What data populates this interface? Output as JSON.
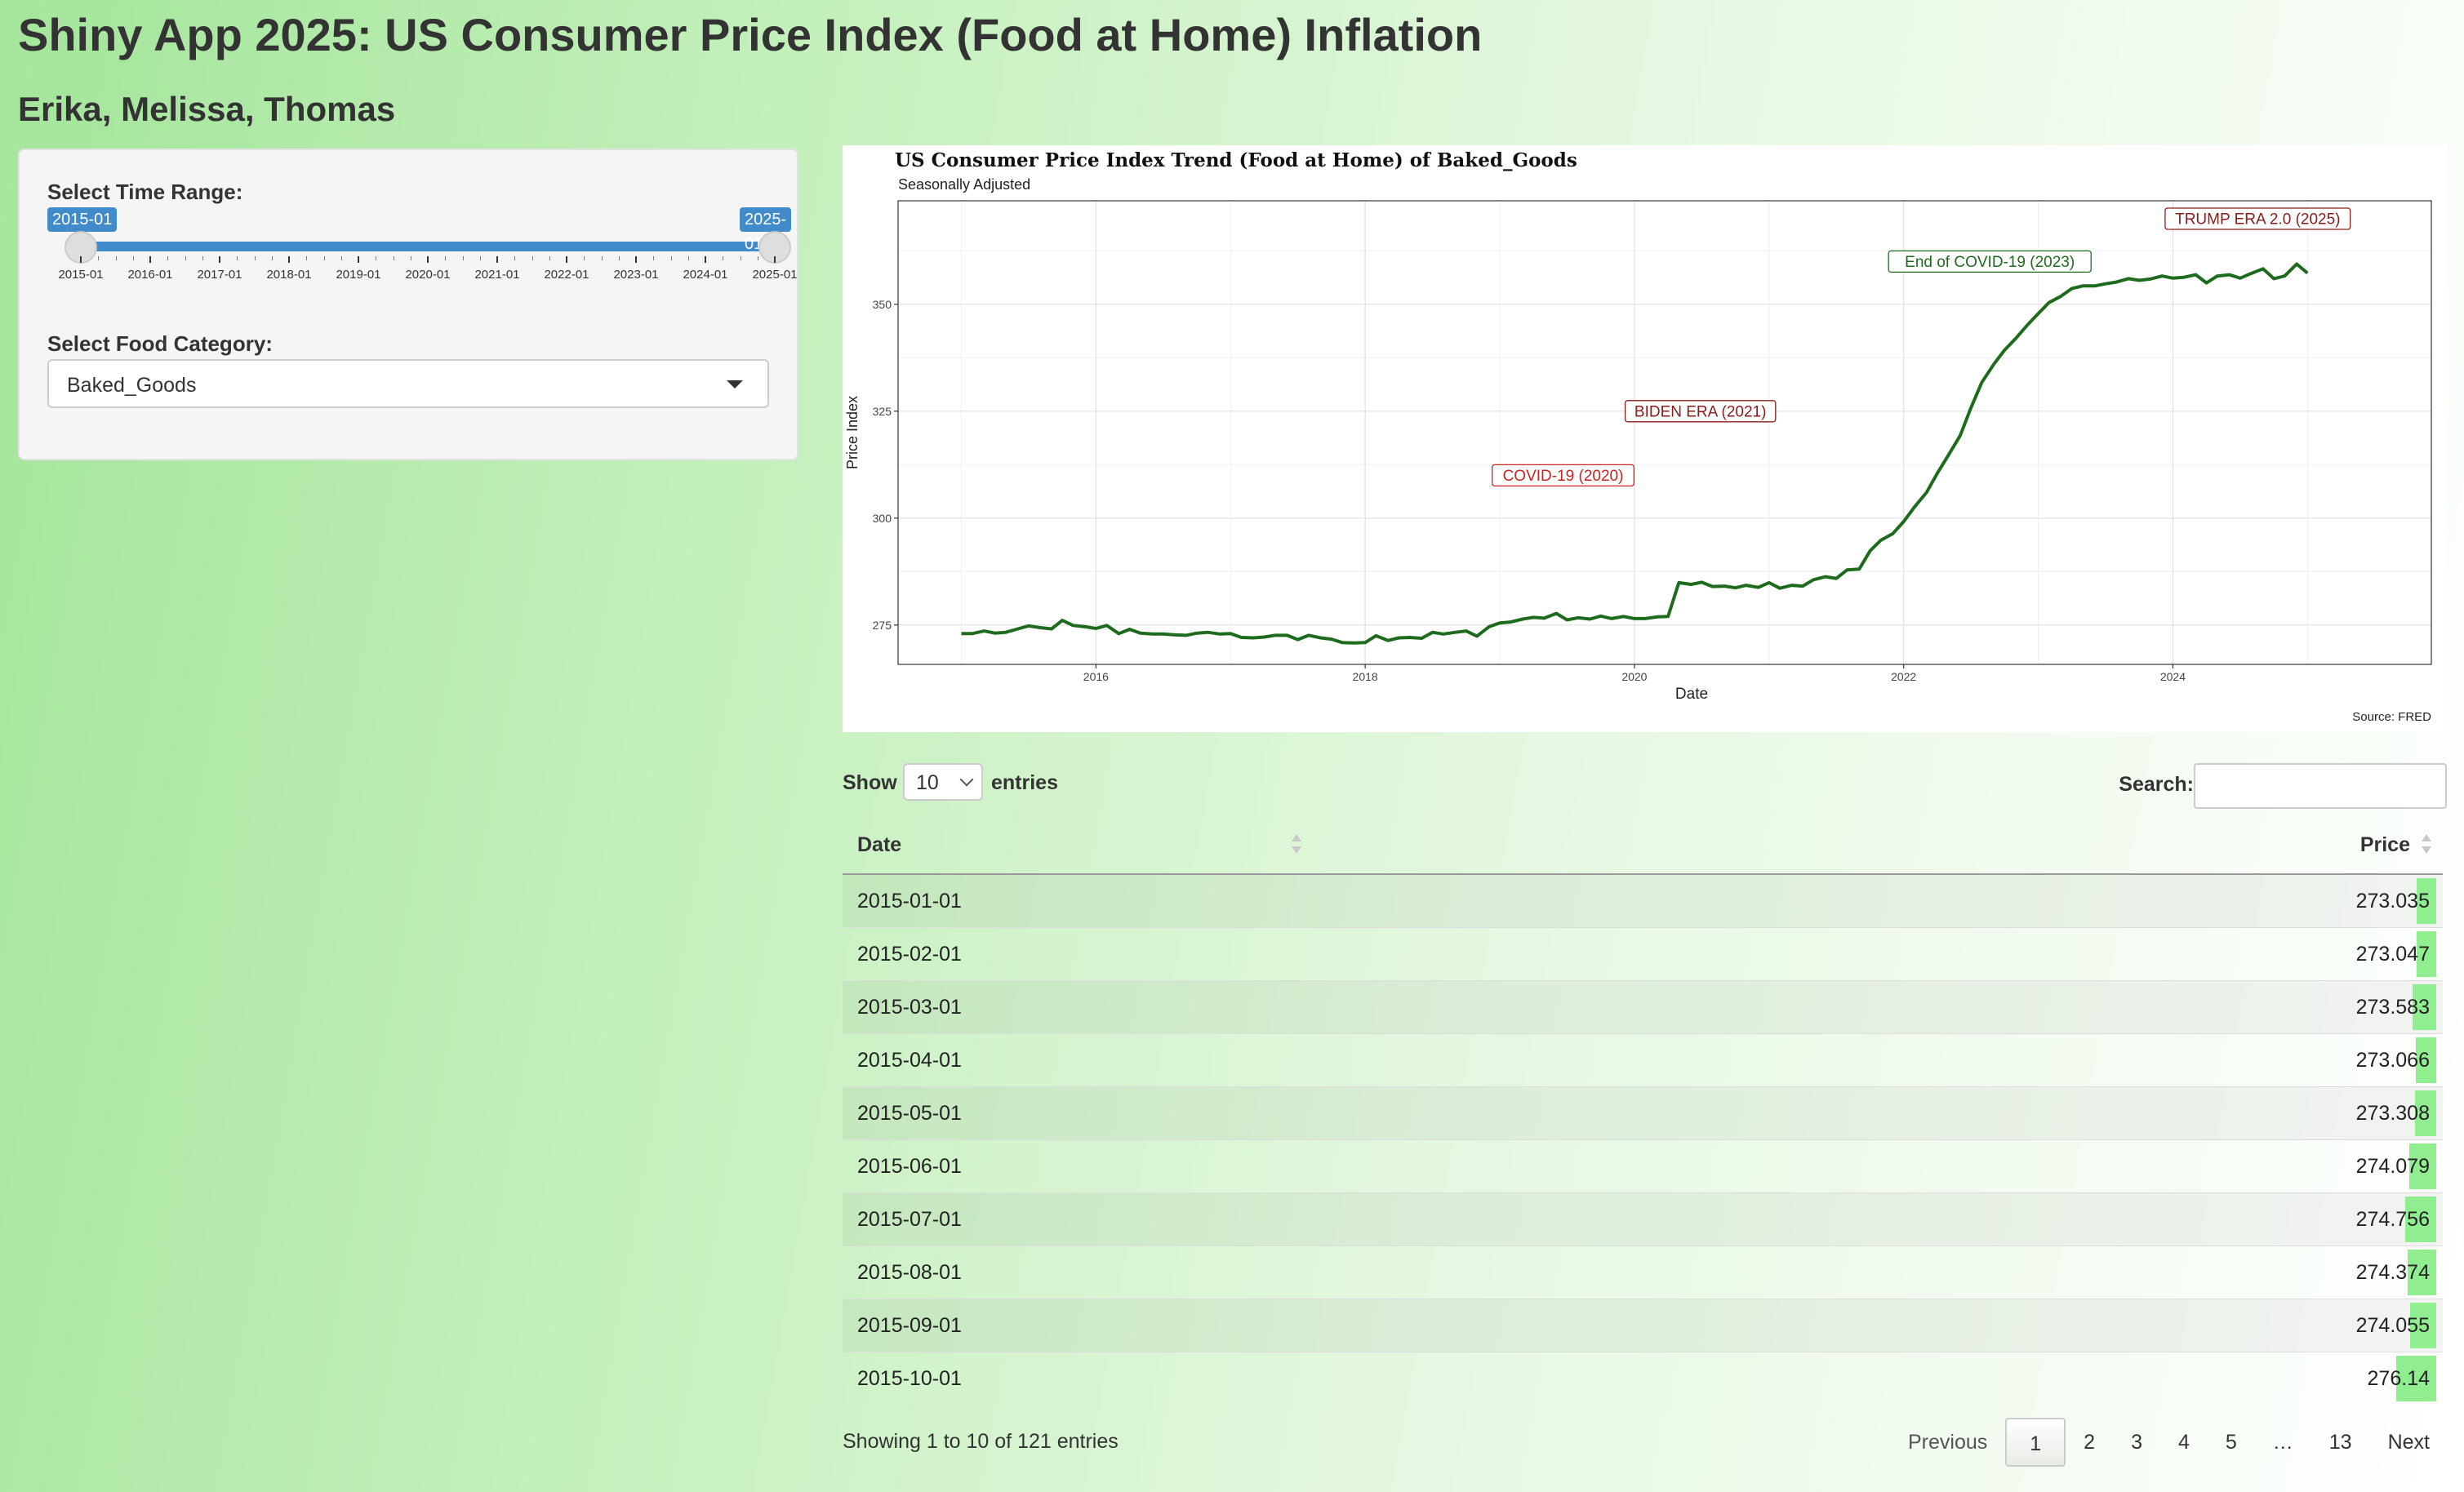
{
  "app": {
    "title": "Shiny App 2025: US Consumer Price Index (Food at Home) Inflation",
    "authors": "Erika, Melissa, Thomas"
  },
  "sidebar": {
    "time_range_label": "Select Time Range:",
    "range_start": "2015-01",
    "range_end": "2025-01",
    "slider_ticks": [
      "2015-01",
      "2016-01",
      "2017-01",
      "2018-01",
      "2019-01",
      "2020-01",
      "2021-01",
      "2022-01",
      "2023-01",
      "2024-01",
      "2025-01"
    ],
    "food_category_label": "Select Food Category:",
    "food_category_value": "Baked_Goods"
  },
  "chart_data": {
    "type": "line",
    "title": "US Consumer Price Index Trend (Food at Home) of Baked_Goods",
    "subtitle": "Seasonally Adjusted",
    "xlabel": "Date",
    "ylabel": "Price Index",
    "caption": "Source: FRED",
    "xlim": [
      2014.53,
      2025.92
    ],
    "ylim": [
      265.8,
      374.2
    ],
    "x_ticks": [
      2016,
      2018,
      2020,
      2022,
      2024
    ],
    "y_ticks": [
      275,
      300,
      325,
      350
    ],
    "grid": true,
    "line_color": "#1e6b1e",
    "series": [
      {
        "x": [
          2015.0,
          2015.08,
          2015.17,
          2015.25,
          2015.33,
          2015.42,
          2015.5,
          2015.58,
          2015.67,
          2015.75,
          2015.83,
          2015.92,
          2016.0,
          2016.08,
          2016.17,
          2016.25,
          2016.33,
          2016.42,
          2016.5,
          2016.58,
          2016.67,
          2016.75,
          2016.83,
          2016.92,
          2017.0,
          2017.08,
          2017.17,
          2017.25,
          2017.33,
          2017.42,
          2017.5,
          2017.58,
          2017.67,
          2017.75,
          2017.83,
          2017.92,
          2018.0,
          2018.08,
          2018.17,
          2018.25,
          2018.33,
          2018.42,
          2018.5,
          2018.58,
          2018.67,
          2018.75,
          2018.83,
          2018.92,
          2019.0,
          2019.08,
          2019.17,
          2019.25,
          2019.33,
          2019.42,
          2019.5,
          2019.58,
          2019.67,
          2019.75,
          2019.83,
          2019.92,
          2020.0,
          2020.08,
          2020.17,
          2020.25,
          2020.33,
          2020.42,
          2020.5,
          2020.58,
          2020.67,
          2020.75,
          2020.83,
          2020.92,
          2021.0,
          2021.08,
          2021.17,
          2021.25,
          2021.33,
          2021.42,
          2021.5,
          2021.58,
          2021.67,
          2021.75,
          2021.83,
          2021.92,
          2022.0,
          2022.08,
          2022.17,
          2022.25,
          2022.33,
          2022.42,
          2022.5,
          2022.58,
          2022.67,
          2022.75,
          2022.83,
          2022.92,
          2023.0,
          2023.08,
          2023.17,
          2023.25,
          2023.33,
          2023.42,
          2023.5,
          2023.58,
          2023.67,
          2023.75,
          2023.83,
          2023.92,
          2024.0,
          2024.08,
          2024.17,
          2024.25,
          2024.33,
          2024.42,
          2024.5,
          2024.58,
          2024.67,
          2024.75,
          2024.83,
          2024.92,
          2025.0
        ],
        "y": [
          273.0,
          273.0,
          273.6,
          273.1,
          273.3,
          274.1,
          274.8,
          274.4,
          274.1,
          276.1,
          274.9,
          274.6,
          274.2,
          274.9,
          273.0,
          274.0,
          273.1,
          272.9,
          272.9,
          272.7,
          272.6,
          273.1,
          273.3,
          272.9,
          273.0,
          272.1,
          272.0,
          272.2,
          272.6,
          272.6,
          271.6,
          272.6,
          272.0,
          271.7,
          270.9,
          270.8,
          270.9,
          272.5,
          271.4,
          272.0,
          272.1,
          271.9,
          273.3,
          272.9,
          273.3,
          273.6,
          272.4,
          274.6,
          275.5,
          275.7,
          276.4,
          276.8,
          276.6,
          277.7,
          276.2,
          276.7,
          276.4,
          277.1,
          276.5,
          277.0,
          276.5,
          276.5,
          276.9,
          277.0,
          284.9,
          284.5,
          285.0,
          284.0,
          284.1,
          283.7,
          284.3,
          283.8,
          284.9,
          283.6,
          284.3,
          284.1,
          285.6,
          286.3,
          285.9,
          287.9,
          288.1,
          292.3,
          294.8,
          296.4,
          299.2,
          302.6,
          306.0,
          310.5,
          314.6,
          319.3,
          325.8,
          331.7,
          336.0,
          339.3,
          341.9,
          345.2,
          347.8,
          350.4,
          351.9,
          353.7,
          354.3,
          354.3,
          354.8,
          355.2,
          356.0,
          355.6,
          355.9,
          356.6,
          356.1,
          356.3,
          356.9,
          355.0,
          356.6,
          356.9,
          356.1,
          357.2,
          358.3,
          356.0,
          356.6,
          359.4,
          357.3
        ]
      }
    ],
    "annotations": [
      {
        "label": "COVID-19 (2020)",
        "x": 2019.47,
        "y": 310,
        "color": "#cc2222"
      },
      {
        "label": "BIDEN ERA (2021)",
        "x": 2020.49,
        "y": 325,
        "color": "#8b1a1a"
      },
      {
        "label": "End of COVID-19 (2023)",
        "x": 2022.64,
        "y": 360,
        "color": "#1e6b1e"
      },
      {
        "label": "TRUMP ERA 2.0 (2025)",
        "x": 2024.63,
        "y": 370,
        "color": "#8b1a1a"
      }
    ]
  },
  "table": {
    "show_label": "Show",
    "length_value": "10",
    "entries_label": "entries",
    "search_label": "Search:",
    "search_value": "",
    "columns": [
      "Date",
      "Price"
    ],
    "rows": [
      {
        "date": "2015-01-01",
        "price": "273.035"
      },
      {
        "date": "2015-02-01",
        "price": "273.047"
      },
      {
        "date": "2015-03-01",
        "price": "273.583"
      },
      {
        "date": "2015-04-01",
        "price": "273.066"
      },
      {
        "date": "2015-05-01",
        "price": "273.308"
      },
      {
        "date": "2015-06-01",
        "price": "274.079"
      },
      {
        "date": "2015-07-01",
        "price": "274.756"
      },
      {
        "date": "2015-08-01",
        "price": "274.374"
      },
      {
        "date": "2015-09-01",
        "price": "274.055"
      },
      {
        "date": "2015-10-01",
        "price": "276.14"
      }
    ],
    "bar_color": "#90ee90",
    "bar_range": [
      270,
      280
    ],
    "info": "Showing 1 to 10 of 121 entries",
    "pagination": {
      "previous": "Previous",
      "pages": [
        "1",
        "2",
        "3",
        "4",
        "5",
        "…",
        "13"
      ],
      "current": "1",
      "next": "Next"
    }
  }
}
